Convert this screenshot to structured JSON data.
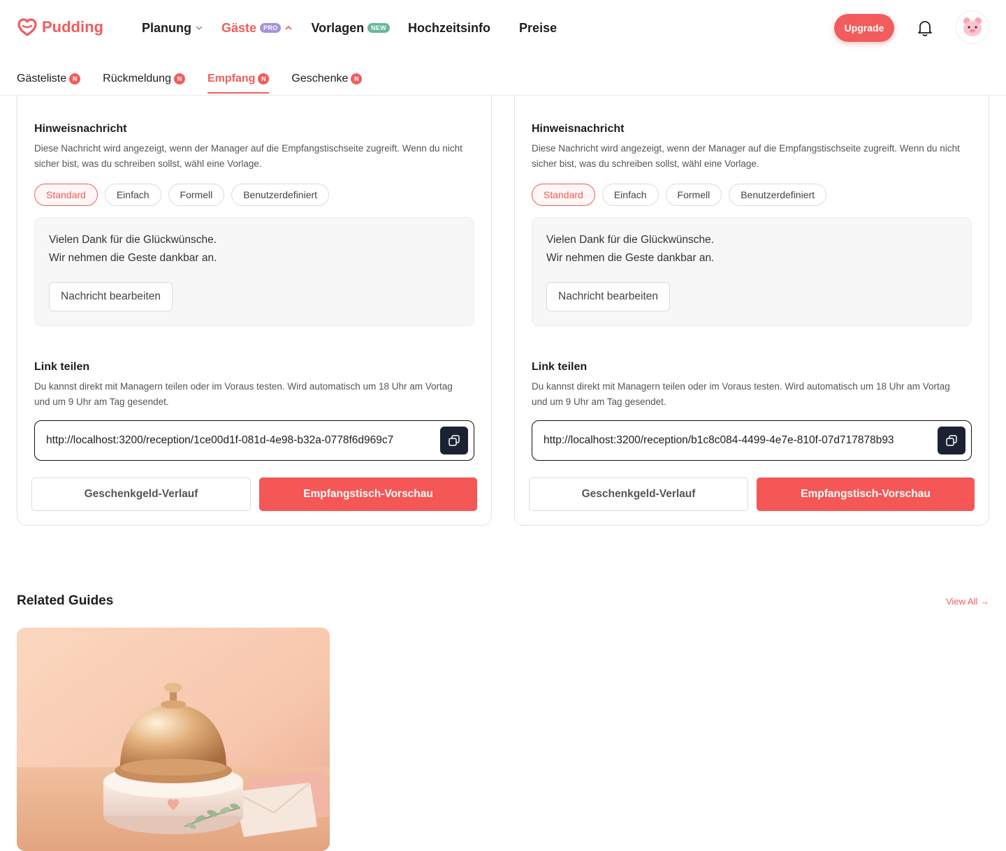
{
  "brand": {
    "name": "Pudding",
    "accent": "#f25c5c"
  },
  "nav": {
    "items": [
      {
        "label": "Planung",
        "badge": "",
        "chevron": "down"
      },
      {
        "label": "Gäste",
        "badge": "PRO",
        "chevron": "up"
      },
      {
        "label": "Vorlagen",
        "badge": "NEW",
        "chevron": ""
      },
      {
        "label": "Hochzeitsinfo",
        "badge": "",
        "chevron": ""
      },
      {
        "label": "Preise",
        "badge": "",
        "chevron": ""
      }
    ],
    "upgrade_label": "Upgrade"
  },
  "subnav": {
    "tabs": [
      {
        "label": "Gästeliste",
        "badge": "N"
      },
      {
        "label": "Rückmeldung",
        "badge": "N"
      },
      {
        "label": "Empfang",
        "badge": "N"
      },
      {
        "label": "Geschenke",
        "badge": "N"
      }
    ],
    "active": "Empfang"
  },
  "cards": [
    {
      "notice_title": "Hinweisnachricht",
      "notice_desc": "Diese Nachricht wird angezeigt, wenn der Manager auf die Empfangstischseite zugreift. Wenn du nicht sicher bist, was du schreiben sollst, wähl eine Vorlage.",
      "templates": [
        "Standard",
        "Einfach",
        "Formell",
        "Benutzerdefiniert"
      ],
      "selected_template": "Standard",
      "message_lines": [
        "Vielen Dank für die Glückwünsche.",
        "Wir nehmen die Geste dankbar an."
      ],
      "edit_label": "Nachricht bearbeiten",
      "share_title": "Link teilen",
      "share_desc": "Du kannst direkt mit Managern teilen oder im Voraus testen. Wird automatisch um 18 Uhr am Vortag und um 9 Uhr am Tag gesendet.",
      "link_url": "http://localhost:3200/reception/1ce00d1f-081d-4e98-b32a-0778f6d969c7",
      "history_label": "Geschenkgeld-Verlauf",
      "preview_label": "Empfangstisch-Vorschau"
    },
    {
      "notice_title": "Hinweisnachricht",
      "notice_desc": "Diese Nachricht wird angezeigt, wenn der Manager auf die Empfangstischseite zugreift. Wenn du nicht sicher bist, was du schreiben sollst, wähl eine Vorlage.",
      "templates": [
        "Standard",
        "Einfach",
        "Formell",
        "Benutzerdefiniert"
      ],
      "selected_template": "Standard",
      "message_lines": [
        "Vielen Dank für die Glückwünsche.",
        "Wir nehmen die Geste dankbar an."
      ],
      "edit_label": "Nachricht bearbeiten",
      "share_title": "Link teilen",
      "share_desc": "Du kannst direkt mit Managern teilen oder im Voraus testen. Wird automatisch um 18 Uhr am Vortag und um 9 Uhr am Tag gesendet.",
      "link_url": "http://localhost:3200/reception/b1c8c084-4499-4e7e-810f-07d717878b93",
      "history_label": "Geschenkgeld-Verlauf",
      "preview_label": "Empfangstisch-Vorschau"
    }
  ],
  "related": {
    "title": "Related Guides",
    "view_all": "View All →",
    "guides": [
      {
        "image": "reception-bell-illustration"
      }
    ]
  },
  "icons": {
    "logo": "heart-logo-icon",
    "bell": "bell-icon",
    "avatar": "pig-avatar-icon",
    "copy": "copy-icon"
  }
}
